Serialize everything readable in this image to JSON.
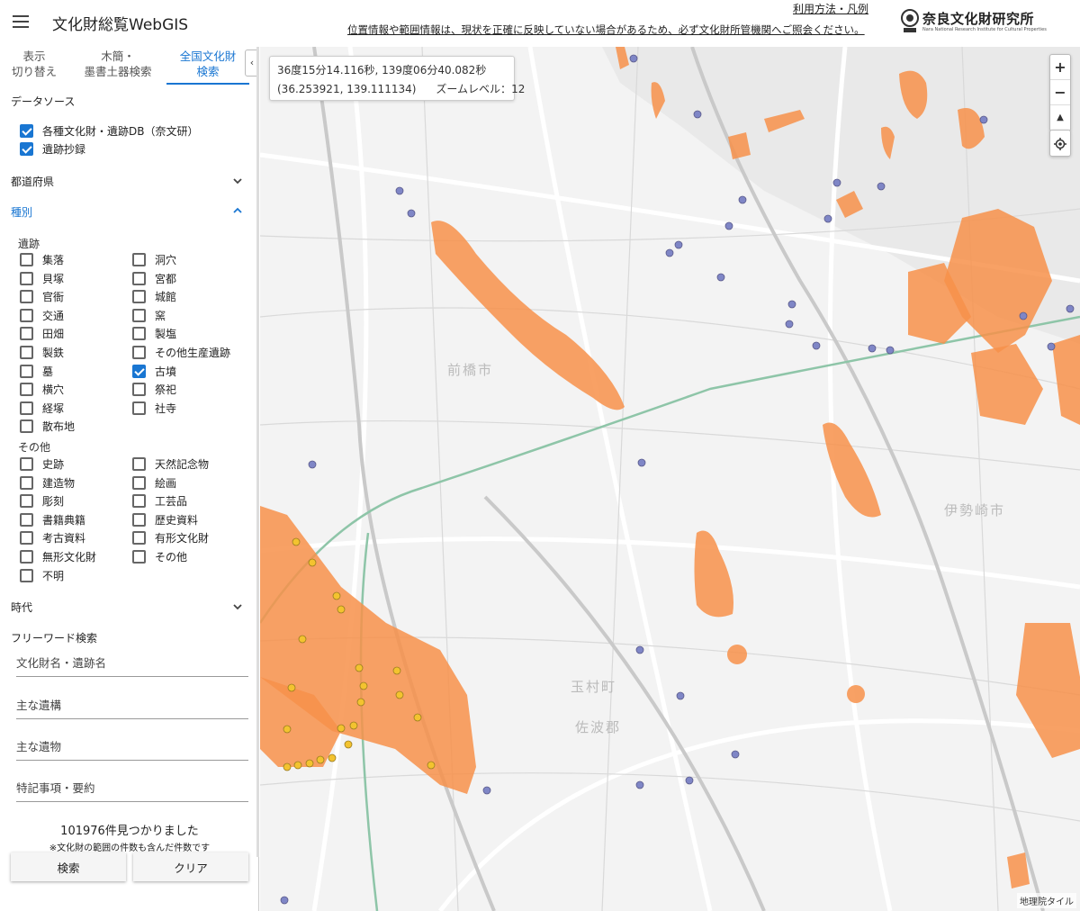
{
  "header": {
    "title": "文化財総覧WebGIS",
    "help_link": "利用方法・凡例",
    "notice": "位置情報や範囲情報は、現状を正確に反映していない場合があるため、必ず文化財所管機関へご照会ください。",
    "logo_text": "奈良文化財研究所",
    "logo_subtext": "Nara National Research Institute for Cultural Properties"
  },
  "sidebar": {
    "tabs": [
      {
        "label_line1": "表示",
        "label_line2": "切り替え",
        "active": false
      },
      {
        "label_line1": "木簡・",
        "label_line2": "墨書土器検索",
        "active": false
      },
      {
        "label_line1": "全国文化財",
        "label_line2": "検索",
        "active": true
      }
    ],
    "collapse_icon": "‹",
    "datasource_label": "データソース",
    "datasources": [
      {
        "label": "各種文化財・遺跡DB（奈文研）",
        "checked": true
      },
      {
        "label": "遺跡抄録",
        "checked": true
      }
    ],
    "prefecture_label": "都道府県",
    "category_label": "種別",
    "iseki_label": "遺跡",
    "iseki_left": [
      {
        "label": "集落",
        "checked": false
      },
      {
        "label": "貝塚",
        "checked": false
      },
      {
        "label": "官衙",
        "checked": false
      },
      {
        "label": "交通",
        "checked": false
      },
      {
        "label": "田畑",
        "checked": false
      },
      {
        "label": "製鉄",
        "checked": false
      },
      {
        "label": "墓",
        "checked": false
      },
      {
        "label": "横穴",
        "checked": false
      },
      {
        "label": "経塚",
        "checked": false
      },
      {
        "label": "散布地",
        "checked": false
      }
    ],
    "iseki_right": [
      {
        "label": "洞穴",
        "checked": false
      },
      {
        "label": "宮都",
        "checked": false
      },
      {
        "label": "城館",
        "checked": false
      },
      {
        "label": "窯",
        "checked": false
      },
      {
        "label": "製塩",
        "checked": false
      },
      {
        "label": "その他生産遺跡",
        "checked": false
      },
      {
        "label": "古墳",
        "checked": true
      },
      {
        "label": "祭祀",
        "checked": false
      },
      {
        "label": "社寺",
        "checked": false
      }
    ],
    "other_label": "その他",
    "other_left": [
      {
        "label": "史跡",
        "checked": false
      },
      {
        "label": "建造物",
        "checked": false
      },
      {
        "label": "彫刻",
        "checked": false
      },
      {
        "label": "書籍典籍",
        "checked": false
      },
      {
        "label": "考古資料",
        "checked": false
      },
      {
        "label": "無形文化財",
        "checked": false
      },
      {
        "label": "不明",
        "checked": false
      }
    ],
    "other_right": [
      {
        "label": "天然記念物",
        "checked": false
      },
      {
        "label": "絵画",
        "checked": false
      },
      {
        "label": "工芸品",
        "checked": false
      },
      {
        "label": "歴史資料",
        "checked": false
      },
      {
        "label": "有形文化財",
        "checked": false
      },
      {
        "label": "その他",
        "checked": false
      }
    ],
    "era_label": "時代",
    "freeword_label": "フリーワード検索",
    "fields": [
      {
        "placeholder": "文化財名・遺跡名",
        "value": ""
      },
      {
        "placeholder": "主な遺構",
        "value": ""
      },
      {
        "placeholder": "主な遺物",
        "value": ""
      },
      {
        "placeholder": "特記事項・要約",
        "value": ""
      }
    ],
    "result_count": "101976件見つかりました",
    "result_note": "※文化財の範囲の件数も含んだ件数です",
    "search_button": "検索",
    "clear_button": "クリア"
  },
  "map": {
    "coord_dms": "36度15分14.116秒, 139度06分40.082秒",
    "coord_decimal": "(36.253921, 139.111134)",
    "zoom_text": "ズームレベル：12",
    "zoom_in": "+",
    "zoom_out": "−",
    "north": "▲",
    "locate_icon": "locate-icon",
    "attribution": "地理院タイル",
    "place_labels": [
      "前橋市",
      "伊勢崎市",
      "玉村町",
      "佐波郡"
    ],
    "colors": {
      "site_area": "#f7914a",
      "site_area_dark": "#f47b28",
      "point_blue": "#7f86c6",
      "point_yellow": "#f3c32f",
      "river": "#c6c6c6",
      "railway": "#8ec5a8"
    }
  }
}
